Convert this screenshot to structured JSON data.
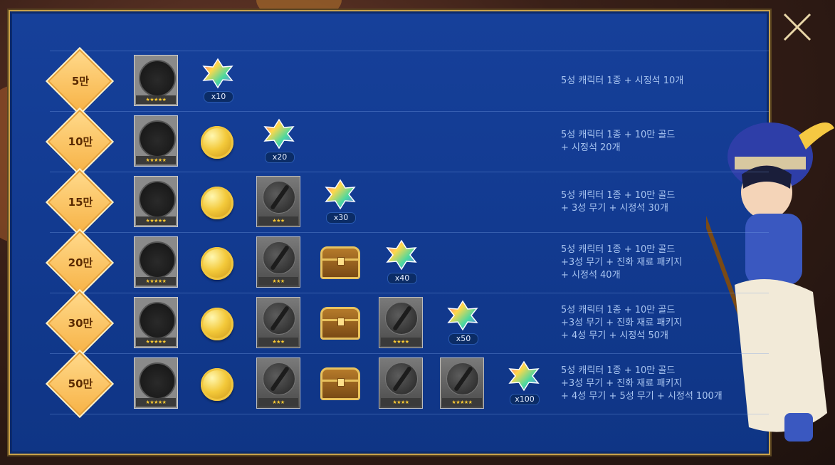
{
  "close_icon": "close-icon",
  "tiers": [
    {
      "label": "5만",
      "items": [
        {
          "type": "character",
          "stars": "★★★★★"
        },
        {
          "type": "gem",
          "count": "x10"
        }
      ],
      "desc": "5성 캐릭터 1종 + 시정석 10개"
    },
    {
      "label": "10만",
      "items": [
        {
          "type": "character",
          "stars": "★★★★★"
        },
        {
          "type": "gold"
        },
        {
          "type": "gem",
          "count": "x20"
        }
      ],
      "desc": "5성 캐릭터 1종 + 10만 골드\n+ 시정석 20개"
    },
    {
      "label": "15만",
      "items": [
        {
          "type": "character",
          "stars": "★★★★★"
        },
        {
          "type": "gold"
        },
        {
          "type": "weapon",
          "stars": "★★★"
        },
        {
          "type": "gem",
          "count": "x30"
        }
      ],
      "desc": "5성 캐릭터 1종 + 10만 골드\n+ 3성 무기 + 시정석 30개"
    },
    {
      "label": "20만",
      "items": [
        {
          "type": "character",
          "stars": "★★★★★"
        },
        {
          "type": "gold"
        },
        {
          "type": "weapon",
          "stars": "★★★"
        },
        {
          "type": "chest"
        },
        {
          "type": "gem",
          "count": "x40"
        }
      ],
      "desc": "5성 캐릭터 1종 + 10만 골드\n+3성 무기 + 진화 재료 패키지\n+ 시정석 40개"
    },
    {
      "label": "30만",
      "items": [
        {
          "type": "character",
          "stars": "★★★★★"
        },
        {
          "type": "gold"
        },
        {
          "type": "weapon",
          "stars": "★★★"
        },
        {
          "type": "chest"
        },
        {
          "type": "weapon",
          "stars": "★★★★"
        },
        {
          "type": "gem",
          "count": "x50"
        }
      ],
      "desc": "5성 캐릭터 1종 + 10만 골드\n+3성 무기 + 진화 재료 패키지\n+ 4성 무기 + 시정석 50개"
    },
    {
      "label": "50만",
      "items": [
        {
          "type": "character",
          "stars": "★★★★★"
        },
        {
          "type": "gold"
        },
        {
          "type": "weapon",
          "stars": "★★★"
        },
        {
          "type": "chest"
        },
        {
          "type": "weapon",
          "stars": "★★★★"
        },
        {
          "type": "weapon",
          "stars": "★★★★★"
        },
        {
          "type": "gem",
          "count": "x100"
        }
      ],
      "desc": "5성 캐릭터 1종 + 10만 골드\n+3성 무기 + 진화 재료 패키지\n+ 4성 무기 + 5성 무기 + 시정석 100개"
    }
  ]
}
